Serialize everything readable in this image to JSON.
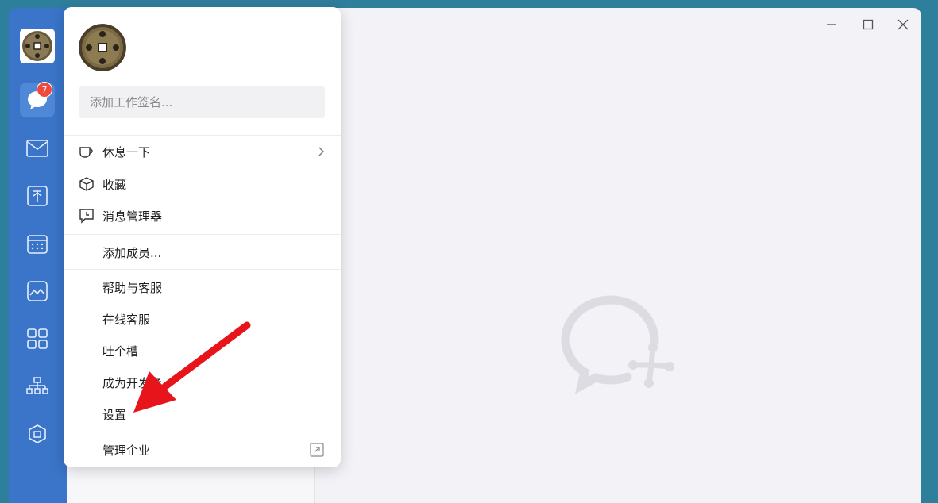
{
  "rail": {
    "chat_badge_count": "7",
    "icons": [
      "avatar",
      "chat-icon",
      "mail-icon",
      "docs-icon",
      "calendar-icon",
      "workbench-icon",
      "apps-icon",
      "org-icon",
      "cube-icon"
    ]
  },
  "window": {
    "controls": [
      "minimize-icon",
      "maximize-icon",
      "close-icon"
    ]
  },
  "popup": {
    "signature_placeholder": "添加工作签名...",
    "menu": {
      "rest": "休息一下",
      "favorites": "收藏",
      "message_manager": "消息管理器",
      "add_member": "添加成员...",
      "help": "帮助与客服",
      "online_support": "在线客服",
      "feedback": "吐个槽",
      "developer": "成为开发者",
      "settings": "设置",
      "manage_company": "管理企业"
    }
  },
  "colors": {
    "desktop": "#2e7f9c",
    "rail": "#3a75c9",
    "badge": "#f04a3e",
    "annotation_arrow": "#e8141c"
  }
}
